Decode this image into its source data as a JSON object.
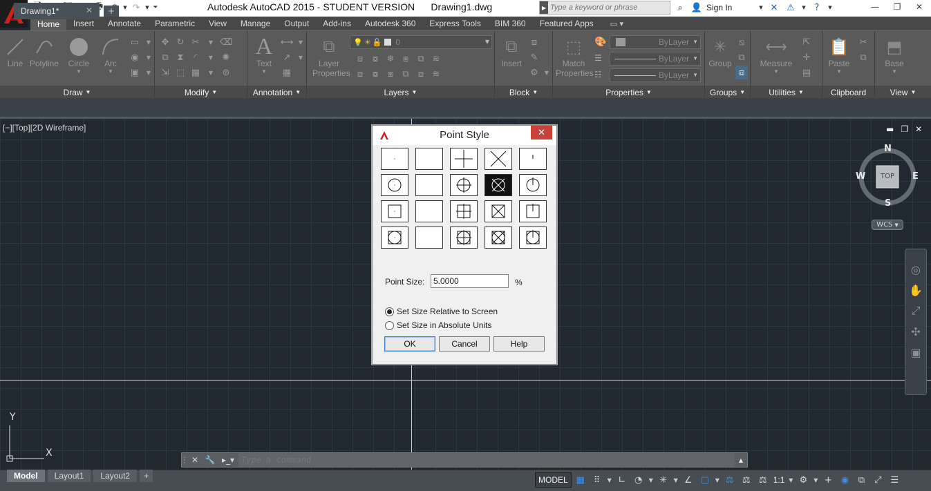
{
  "window": {
    "title": "Autodesk AutoCAD 2015 - STUDENT VERSION      Drawing1.dwg",
    "search_placeholder": "Type a keyword or phrase",
    "sign_in": "Sign In"
  },
  "ribbon_tabs": [
    "Home",
    "Insert",
    "Annotate",
    "Parametric",
    "View",
    "Manage",
    "Output",
    "Add-ins",
    "Autodesk 360",
    "Express Tools",
    "BIM 360",
    "Featured Apps"
  ],
  "ribbon": {
    "draw": {
      "label": "Draw",
      "tools": [
        "Line",
        "Polyline",
        "Circle",
        "Arc"
      ]
    },
    "modify": {
      "label": "Modify"
    },
    "annotation": {
      "label": "Annotation",
      "text": "Text"
    },
    "layers": {
      "label": "Layers",
      "layer_properties_l1": "Layer",
      "layer_properties_l2": "Properties",
      "layer_value": "0"
    },
    "block": {
      "label": "Block",
      "insert": "Insert"
    },
    "properties": {
      "label": "Properties",
      "match_l1": "Match",
      "match_l2": "Properties",
      "color": "ByLayer",
      "linetype": "ByLayer",
      "lineweight": "ByLayer"
    },
    "groups": {
      "label": "Groups",
      "group": "Group"
    },
    "utilities": {
      "label": "Utilities",
      "measure": "Measure"
    },
    "clipboard": {
      "label": "Clipboard",
      "paste": "Paste"
    },
    "view": {
      "label": "View",
      "base": "Base"
    }
  },
  "doc_tab": {
    "name": "Drawing1*"
  },
  "viewport_label": "[−][Top][2D Wireframe]",
  "viewcube": {
    "top": "TOP",
    "north": "N",
    "south": "S",
    "east": "E",
    "west": "W",
    "wcs": "WCS"
  },
  "ucs": {
    "x": "X",
    "y": "Y"
  },
  "command_line": {
    "placeholder": "Type a command"
  },
  "layout_tabs": [
    "Model",
    "Layout1",
    "Layout2"
  ],
  "status": {
    "model": "MODEL",
    "scale": "1:1"
  },
  "dialog": {
    "title": "Point Style",
    "point_size_label": "Point Size:",
    "point_size_value": "5.0000",
    "percent": "%",
    "radio_relative": "Set Size Relative to Screen",
    "radio_absolute": "Set Size in Absolute Units",
    "ok": "OK",
    "cancel": "Cancel",
    "help": "Help",
    "styles": [
      "dot",
      "none",
      "plus",
      "x",
      "tick",
      "circle-dot",
      "circle",
      "circle-plus",
      "circle-x",
      "circle-tick",
      "square-dot",
      "square",
      "square-plus",
      "square-x",
      "square-tick",
      "circsq-dot",
      "circsq",
      "circsq-plus",
      "circsq-x",
      "circsq-tick"
    ],
    "selected_style": "circle-x"
  }
}
